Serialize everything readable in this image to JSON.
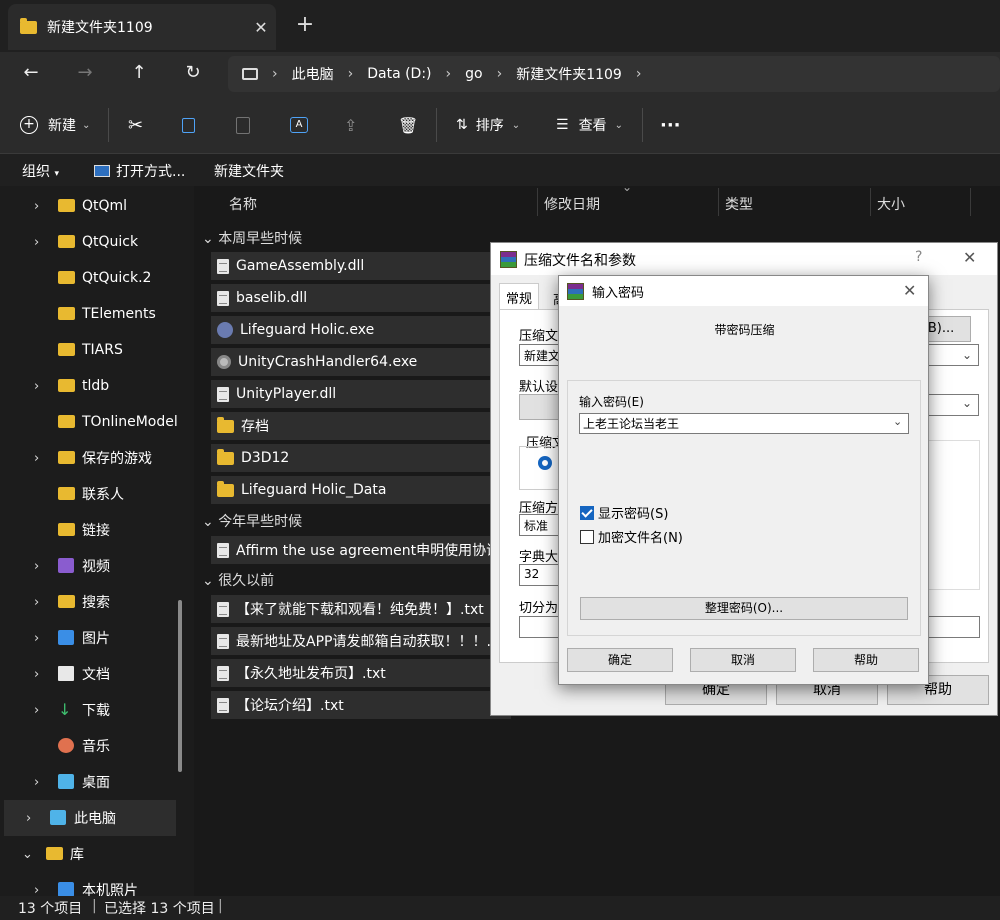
{
  "tab": {
    "title": "新建文件夹1109",
    "close": "✕",
    "new": "+"
  },
  "address": {
    "crumbs": [
      "此电脑",
      "Data (D:)",
      "go",
      "新建文件夹1109"
    ]
  },
  "toolbar": {
    "new_label": "新建",
    "sort_label": "排序",
    "view_label": "查看",
    "more": "···"
  },
  "cmdbar": {
    "organize": "组织",
    "open_with": "打开方式...",
    "new_folder": "新建文件夹"
  },
  "sidebar": {
    "items": [
      {
        "label": "QtQml",
        "chev": "›",
        "icon": "folder-icon"
      },
      {
        "label": "QtQuick",
        "chev": "›",
        "icon": "folder-icon"
      },
      {
        "label": "QtQuick.2",
        "chev": "",
        "icon": "folder-icon"
      },
      {
        "label": "TElements",
        "chev": "",
        "icon": "folder-icon"
      },
      {
        "label": "TIARS",
        "chev": "",
        "icon": "folder-icon"
      },
      {
        "label": "tldb",
        "chev": "›",
        "icon": "folder-icon"
      },
      {
        "label": "TOnlineModel",
        "chev": "",
        "icon": "folder-icon"
      },
      {
        "label": "保存的游戏",
        "chev": "›",
        "icon": "folder-icon"
      },
      {
        "label": "联系人",
        "chev": "",
        "icon": "folder-icon"
      },
      {
        "label": "链接",
        "chev": "",
        "icon": "folder-icon"
      },
      {
        "label": "视频",
        "chev": "›",
        "icon": "video-icon"
      },
      {
        "label": "搜索",
        "chev": "›",
        "icon": "folder-icon"
      },
      {
        "label": "图片",
        "chev": "›",
        "icon": "picture-icon"
      },
      {
        "label": "文档",
        "chev": "›",
        "icon": "document-icon"
      },
      {
        "label": "下载",
        "chev": "›",
        "icon": "download-icon"
      },
      {
        "label": "音乐",
        "chev": "",
        "icon": "music-icon"
      },
      {
        "label": "桌面",
        "chev": "›",
        "icon": "desktop-icon"
      },
      {
        "label": "此电脑",
        "chev": "›",
        "icon": "computer-icon"
      },
      {
        "label": "库",
        "chev": "⌄",
        "icon": "folder-icon"
      },
      {
        "label": "本机照片",
        "chev": "›",
        "icon": "picture-icon"
      }
    ]
  },
  "columns": {
    "name": "名称",
    "modified": "修改日期",
    "type": "类型",
    "size": "大小"
  },
  "groups": {
    "this_week": "本周早些时候",
    "this_year": "今年早些时候",
    "long_ago": "很久以前",
    "arrow": "⌄"
  },
  "files": {
    "week": [
      {
        "name": "GameAssembly.dll",
        "icon": "gear-file-icon"
      },
      {
        "name": "baselib.dll",
        "icon": "gear-file-icon"
      },
      {
        "name": "Lifeguard Holic.exe",
        "icon": "app-icon"
      },
      {
        "name": "UnityCrashHandler64.exe",
        "icon": "unity-icon"
      },
      {
        "name": "UnityPlayer.dll",
        "icon": "gear-file-icon"
      },
      {
        "name": "存档",
        "icon": "folder-icon"
      },
      {
        "name": "D3D12",
        "icon": "folder-icon"
      },
      {
        "name": "Lifeguard Holic_Data",
        "icon": "folder-icon"
      }
    ],
    "year": [
      {
        "name": "Affirm the use agreement申明使用协议.txt",
        "icon": "text-file-icon"
      }
    ],
    "long_ago": [
      {
        "name": "【来了就能下载和观看！纯免费！】.txt",
        "icon": "text-file-icon"
      },
      {
        "name": "最新地址及APP请发邮箱自动获取！！！.txt",
        "icon": "text-file-icon"
      },
      {
        "name": "【永久地址发布页】.txt",
        "icon": "text-file-icon"
      },
      {
        "name": "【论坛介绍】.txt",
        "icon": "text-file-icon"
      }
    ]
  },
  "status": {
    "count": "13 个项目",
    "selected": "已选择 13 个项目"
  },
  "dialog1": {
    "title": "压缩文件名和参数",
    "help": "?",
    "close": "✕",
    "tab_general": "常规",
    "tab_advanced_partial": "高",
    "archive_name_label": "压缩文件",
    "archive_name_value": "新建文",
    "browse": "(B)...",
    "default_profile": "默认设置",
    "format_label": "压缩文",
    "method_label": "压缩方式",
    "method_value": "标准",
    "dict_label": "字典大小",
    "dict_value": "32",
    "split_label": "切分为分",
    "ok": "确定",
    "cancel": "取消",
    "help_btn": "帮助"
  },
  "dialog2": {
    "title": "输入密码",
    "close": "✕",
    "subtitle": "带密码压缩",
    "pwd_label": "输入密码(E)",
    "pwd_value": "上老王论坛当老王",
    "show_pwd": "显示密码(S)",
    "show_pwd_checked": true,
    "encrypt_names": "加密文件名(N)",
    "encrypt_names_checked": false,
    "organize": "整理密码(O)...",
    "ok": "确定",
    "cancel": "取消",
    "help": "帮助"
  }
}
